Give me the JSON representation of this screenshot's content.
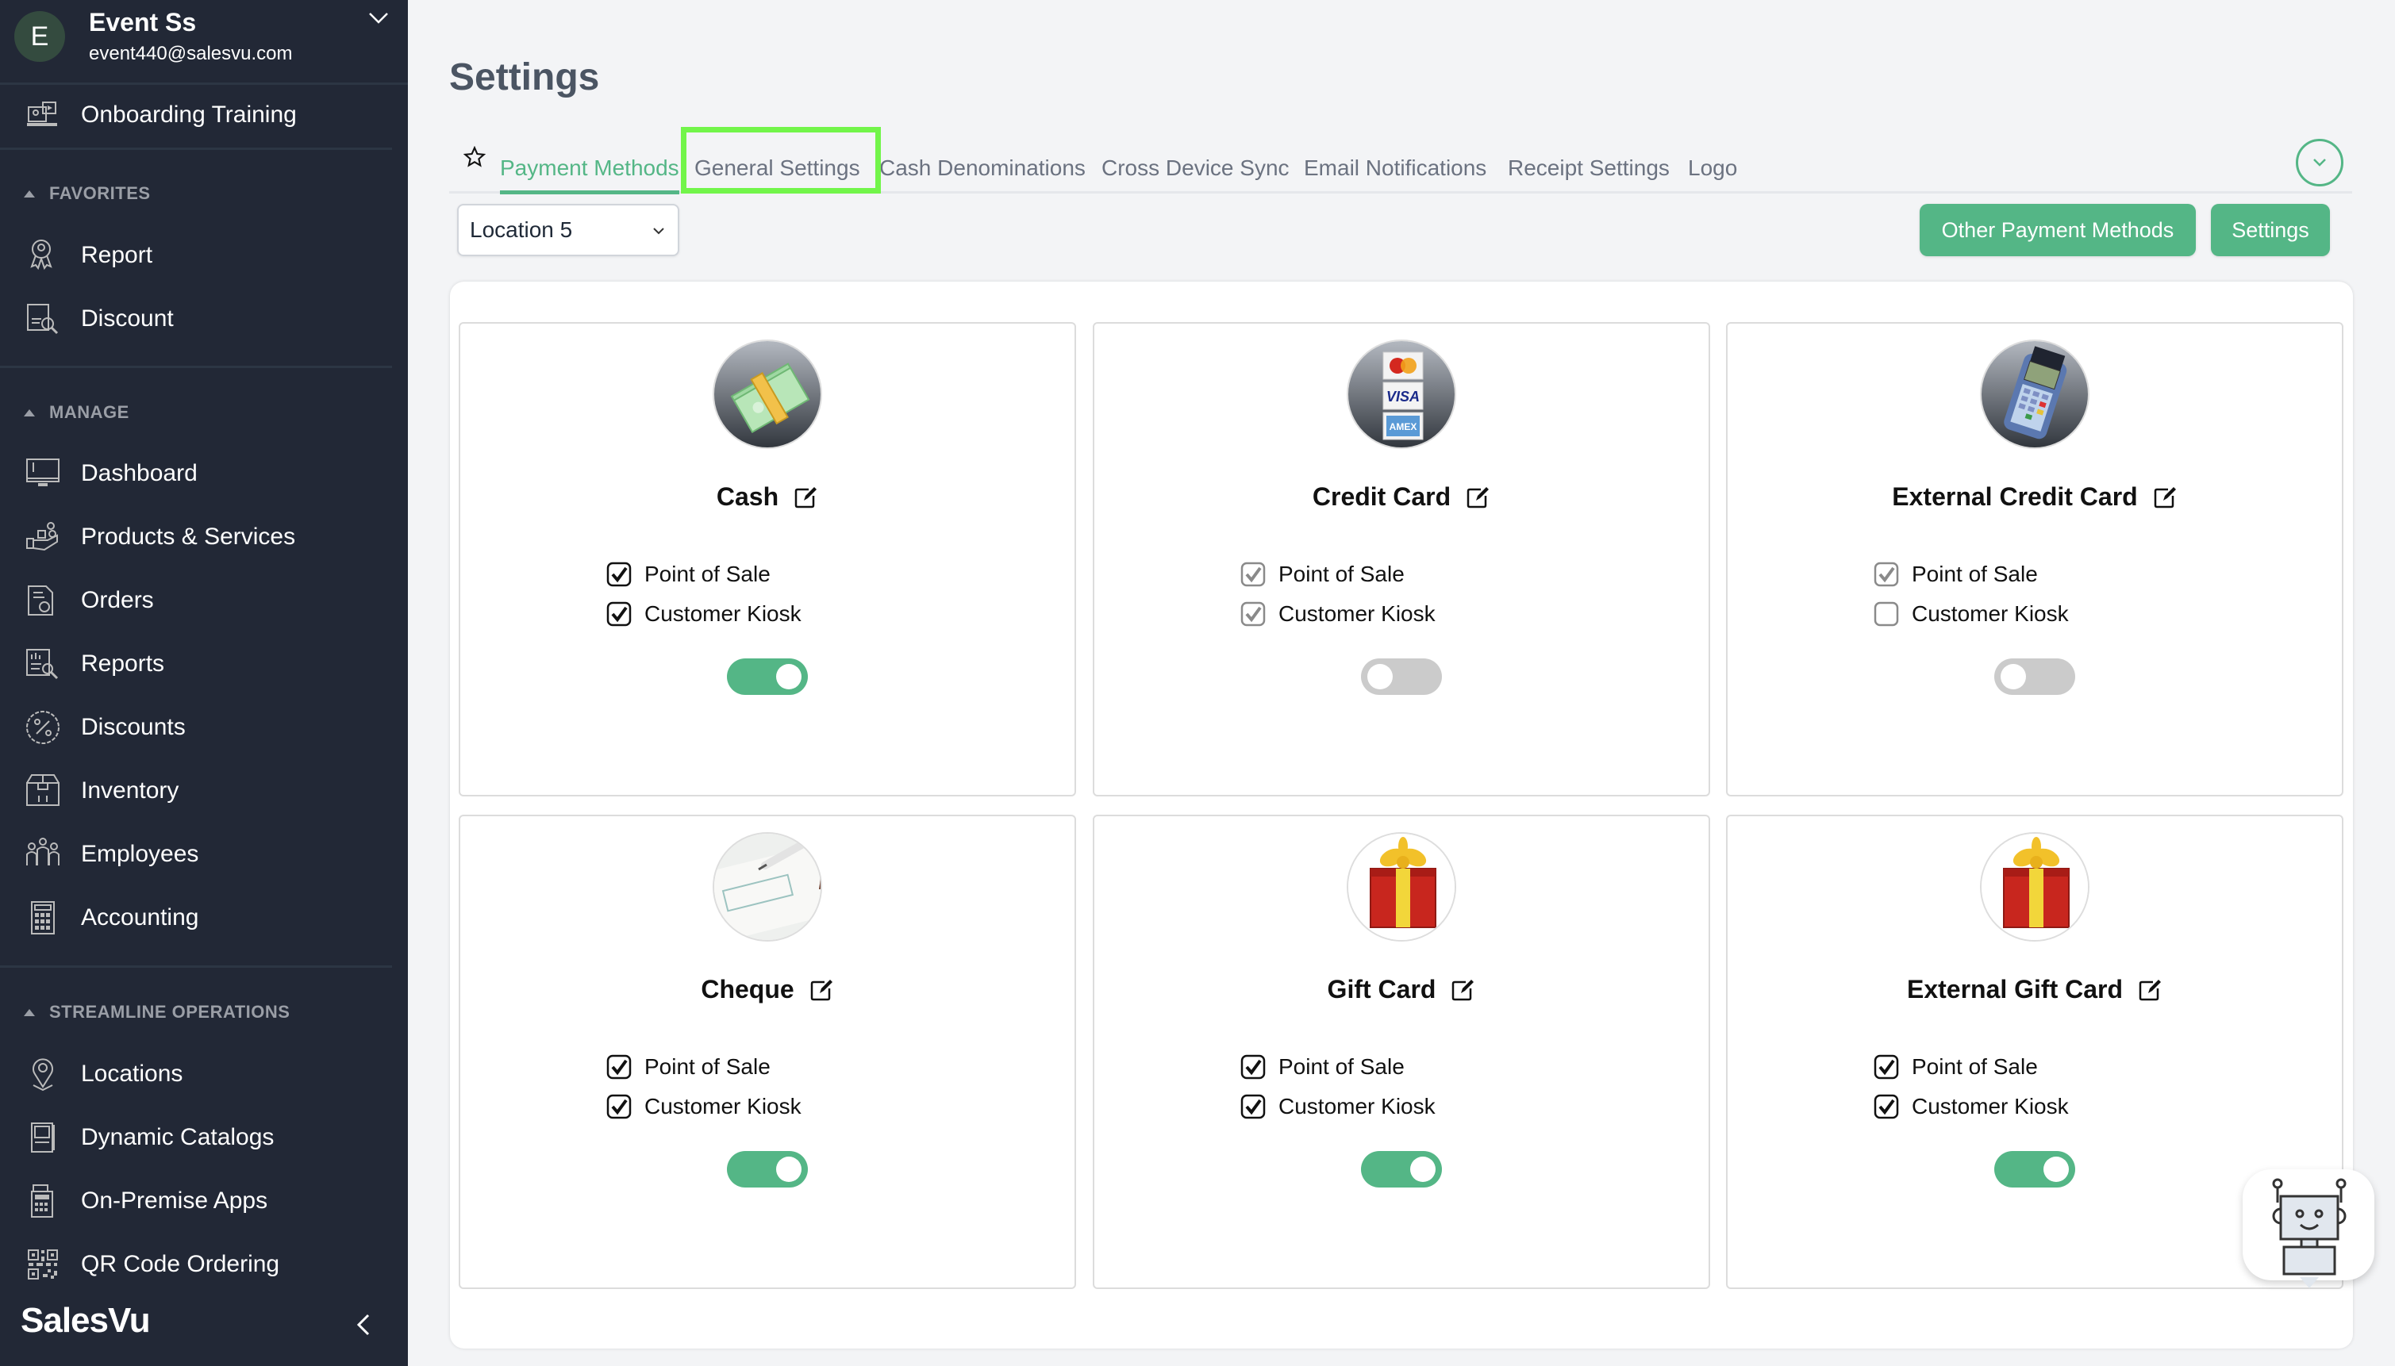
{
  "sidebar": {
    "profile": {
      "initial": "E",
      "name": "Event Ss",
      "email": "event440@salesvu.com"
    },
    "top_items": [
      {
        "label": "Onboarding Training",
        "icon": "onboarding-training-icon"
      }
    ],
    "sections": [
      {
        "title": "FAVORITES",
        "items": [
          {
            "label": "Report",
            "icon": "report-badge-icon"
          },
          {
            "label": "Discount",
            "icon": "discount-report-icon"
          }
        ]
      },
      {
        "title": "MANAGE",
        "items": [
          {
            "label": "Dashboard",
            "icon": "monitor-icon"
          },
          {
            "label": "Products & Services",
            "icon": "products-icon"
          },
          {
            "label": "Orders",
            "icon": "orders-icon"
          },
          {
            "label": "Reports",
            "icon": "reports-icon"
          },
          {
            "label": "Discounts",
            "icon": "percent-badge-icon"
          },
          {
            "label": "Inventory",
            "icon": "inventory-box-icon"
          },
          {
            "label": "Employees",
            "icon": "employees-icon"
          },
          {
            "label": "Accounting",
            "icon": "calculator-icon"
          }
        ]
      },
      {
        "title": "STREAMLINE OPERATIONS",
        "items": [
          {
            "label": "Locations",
            "icon": "location-pin-icon"
          },
          {
            "label": "Dynamic Catalogs",
            "icon": "catalog-icon"
          },
          {
            "label": "On-Premise Apps",
            "icon": "pos-terminal-icon"
          },
          {
            "label": "QR Code Ordering",
            "icon": "qr-code-icon"
          }
        ]
      }
    ],
    "brand": "SalesVu"
  },
  "page": {
    "title": "Settings",
    "tabs": [
      {
        "label": "Payment Methods",
        "active": true
      },
      {
        "label": "General Settings",
        "active": false,
        "highlighted": true
      },
      {
        "label": "Cash Denominations",
        "active": false
      },
      {
        "label": "Cross Device Sync",
        "active": false
      },
      {
        "label": "Email Notifications",
        "active": false
      },
      {
        "label": "Receipt Settings",
        "active": false
      },
      {
        "label": "Logo",
        "active": false
      }
    ],
    "location_select": {
      "value": "Location 5"
    },
    "buttons": {
      "other_payment_methods": "Other Payment Methods",
      "settings": "Settings"
    }
  },
  "payment_methods": [
    {
      "name": "Cash",
      "image": "cash-stack",
      "point_of_sale": true,
      "customer_kiosk": true,
      "checkbox_disabled": false,
      "enabled": true
    },
    {
      "name": "Credit Card",
      "image": "credit-card-logos",
      "point_of_sale": true,
      "customer_kiosk": true,
      "checkbox_disabled": true,
      "enabled": false
    },
    {
      "name": "External Credit Card",
      "image": "card-terminal",
      "point_of_sale": true,
      "customer_kiosk": false,
      "checkbox_disabled": true,
      "enabled": false
    },
    {
      "name": "Cheque",
      "image": "cheque",
      "point_of_sale": true,
      "customer_kiosk": true,
      "checkbox_disabled": false,
      "enabled": true
    },
    {
      "name": "Gift Card",
      "image": "gift-box",
      "point_of_sale": true,
      "customer_kiosk": true,
      "checkbox_disabled": false,
      "enabled": true
    },
    {
      "name": "External Gift Card",
      "image": "gift-box",
      "point_of_sale": true,
      "customer_kiosk": true,
      "checkbox_disabled": false,
      "enabled": true
    }
  ],
  "labels": {
    "point_of_sale": "Point of Sale",
    "customer_kiosk": "Customer Kiosk"
  },
  "colors": {
    "accent": "#54b686",
    "sidebar_bg": "#222836",
    "page_bg": "#f3f4f6",
    "highlight": "#72f54a"
  }
}
